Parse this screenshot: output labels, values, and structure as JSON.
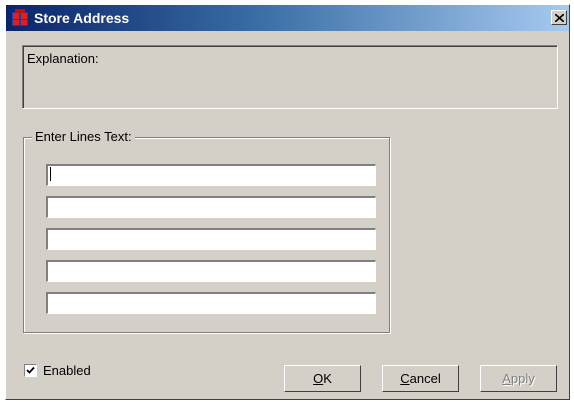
{
  "window": {
    "title": "Store Address",
    "close_glyph": "×"
  },
  "explanation": {
    "label": "Explanation:"
  },
  "lines_group": {
    "label": "Enter Lines Text:",
    "lines": [
      "",
      "",
      "",
      "",
      ""
    ]
  },
  "enabled_checkbox": {
    "label": "Enabled",
    "checked": true
  },
  "buttons": {
    "ok": {
      "mnemonic": "O",
      "rest": "K"
    },
    "cancel": {
      "mnemonic": "C",
      "rest": "ancel"
    },
    "apply": {
      "mnemonic": "A",
      "rest": "pply",
      "disabled": true
    }
  },
  "colors": {
    "face": "#d4d0c8",
    "title_start": "#0a246a",
    "title_end": "#a6caf0"
  },
  "icons": {
    "app": "app-icon",
    "close": "close-icon",
    "check": "check-icon"
  }
}
